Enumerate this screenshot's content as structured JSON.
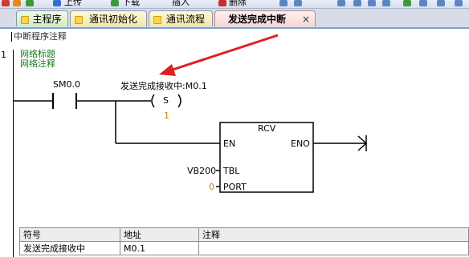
{
  "toolbar": {
    "upload_label": "上传",
    "download_label": "下载",
    "insert_label": "插入",
    "delete_label": "删除"
  },
  "tabs": [
    {
      "label": "主程序"
    },
    {
      "label": "通讯初始化"
    },
    {
      "label": "通讯流程"
    },
    {
      "label": "发送完成中断",
      "close": "×"
    }
  ],
  "comment_bar": "中断程序注释",
  "network": {
    "number": "1",
    "title": "网络标题",
    "comment": "网络注释",
    "contact": {
      "address": "SM0.0"
    },
    "coil": {
      "label": "发送完成接收中:M0.1",
      "type": "S",
      "count": "1"
    },
    "box": {
      "name": "RCV",
      "en": "EN",
      "eno": "ENO",
      "tbl_pin": "TBL",
      "port_pin": "PORT",
      "tbl_value": "VB200",
      "port_value": "0"
    }
  },
  "symbol_table": {
    "headers": [
      "符号",
      "地址",
      "注释"
    ],
    "rows": [
      {
        "symbol": "发送完成接收中",
        "address": "M0.1",
        "comment": ""
      }
    ]
  },
  "colors": {
    "annotation_arrow": "#e02020",
    "network_title": "#1a7a1a",
    "constant": "#b8860b"
  }
}
